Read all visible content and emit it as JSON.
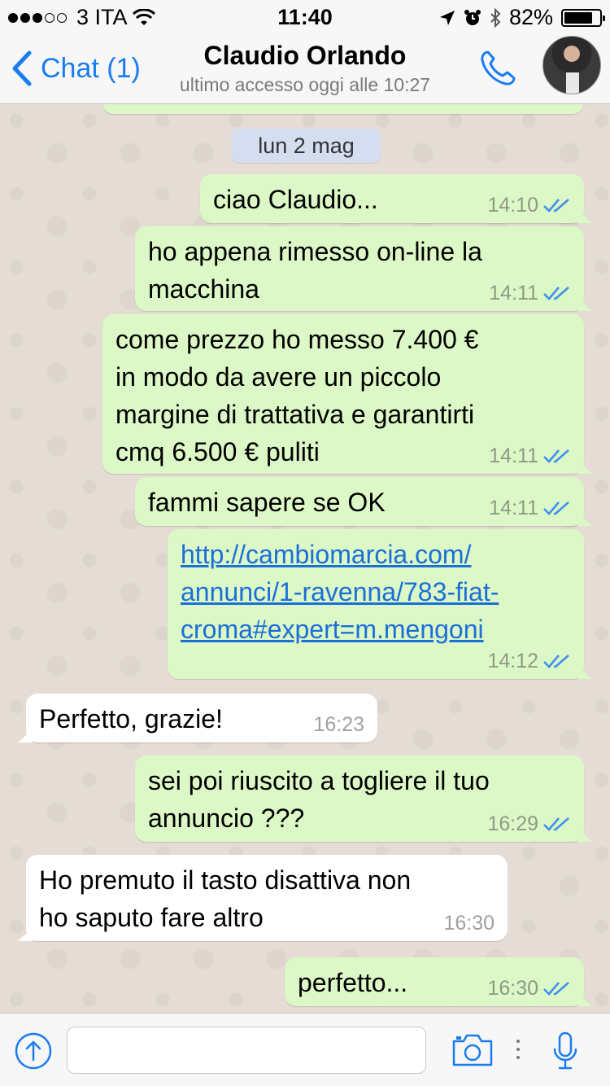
{
  "status_bar": {
    "carrier": "3 ITA",
    "time": "11:40",
    "battery": "82%",
    "battery_level": 0.82,
    "signal_bars_filled": 3,
    "signal_bars_total": 5
  },
  "header": {
    "back_label": "Chat (1)",
    "contact_name": "Claudio Orlando",
    "contact_status": "ultimo accesso oggi alle 10:27"
  },
  "chat": {
    "date_separator": "lun 2 mag",
    "messages": [
      {
        "direction": "outgoing",
        "text": "ciao Claudio...",
        "time": "14:10",
        "read": true
      },
      {
        "direction": "outgoing",
        "text": "ho appena rimesso on-line la\nmacchina",
        "time": "14:11",
        "read": true
      },
      {
        "direction": "outgoing",
        "text": "come prezzo ho messo 7.400 €\nin modo da avere un piccolo\nmargine di trattativa e garantirti\ncmq 6.500 € puliti",
        "time": "14:11",
        "read": true
      },
      {
        "direction": "outgoing",
        "text": "fammi sapere se OK",
        "time": "14:11",
        "read": true
      },
      {
        "direction": "outgoing",
        "text": "http://cambiomarcia.com/\nannunci/1-ravenna/783-fiat-\ncroma#expert=m.mengoni",
        "time": "14:12",
        "read": true,
        "is_link": true
      },
      {
        "direction": "incoming",
        "text": "Perfetto, grazie!",
        "time": "16:23"
      },
      {
        "direction": "outgoing",
        "text": "sei poi riuscito a togliere il tuo\nannuncio ???",
        "time": "16:29",
        "read": true
      },
      {
        "direction": "incoming",
        "text": "Ho premuto il tasto disattiva non\nho saputo fare altro",
        "time": "16:30"
      },
      {
        "direction": "outgoing",
        "text": "perfetto...",
        "time": "16:30",
        "read": true
      }
    ]
  },
  "input_bar": {
    "message_value": "",
    "icons": [
      "share-arrow-icon",
      "camera-icon",
      "more-dots-icon",
      "microphone-icon"
    ]
  },
  "colors": {
    "accent": "#1a7cf0",
    "outgoing_bubble": "#dcf8c6",
    "incoming_bubble": "#ffffff",
    "read_ticks": "#3b8ff0",
    "chat_background": "#e5ddd5"
  }
}
